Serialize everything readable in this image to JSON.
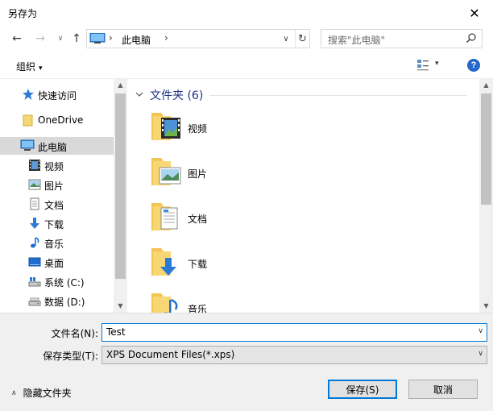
{
  "window": {
    "title": "另存为",
    "close_glyph": "✕"
  },
  "navigation": {
    "back_glyph": "←",
    "forward_glyph": "→",
    "history_glyph": "∨",
    "up_glyph": "↑",
    "address": {
      "separator": "›",
      "crumb": "此电脑",
      "crumb_icon": "pc-icon",
      "dropdown_glyph": "∨",
      "refresh_glyph": "↻"
    },
    "search": {
      "placeholder": "搜索\"此电脑\"",
      "icon": "search-icon"
    }
  },
  "toolbar": {
    "organize_label": "组织",
    "caret": "▾",
    "view_icon": "view-options-icon",
    "help_label": "?"
  },
  "sidebar": {
    "items": [
      {
        "label": "快速访问",
        "icon": "quick-access-star-icon",
        "level": 0
      },
      {
        "label": "OneDrive",
        "icon": "onedrive-folder-icon",
        "level": 0
      },
      {
        "label": "此电脑",
        "icon": "pc-icon",
        "level": 0,
        "selected": true
      },
      {
        "label": "视频",
        "icon": "videos-icon",
        "level": 1
      },
      {
        "label": "图片",
        "icon": "pictures-icon",
        "level": 1
      },
      {
        "label": "文档",
        "icon": "documents-icon",
        "level": 1
      },
      {
        "label": "下载",
        "icon": "downloads-icon",
        "level": 1
      },
      {
        "label": "音乐",
        "icon": "music-icon",
        "level": 1
      },
      {
        "label": "桌面",
        "icon": "desktop-icon",
        "level": 1
      },
      {
        "label": "系统 (C:)",
        "icon": "system-drive-icon",
        "level": 1
      },
      {
        "label": "数据 (D:)",
        "icon": "data-drive-icon",
        "level": 1
      }
    ]
  },
  "content": {
    "group_label": "文件夹 (6)",
    "folders": [
      {
        "label": "视频",
        "icon": "videos-folder-icon"
      },
      {
        "label": "图片",
        "icon": "pictures-folder-icon"
      },
      {
        "label": "文档",
        "icon": "documents-folder-icon"
      },
      {
        "label": "下载",
        "icon": "downloads-folder-icon"
      },
      {
        "label": "音乐",
        "icon": "music-folder-icon"
      }
    ]
  },
  "scroll_glyphs": {
    "up": "▲",
    "down": "▼"
  },
  "form": {
    "filename_label": "文件名(N):",
    "filename_value": "Test",
    "filetype_label": "保存类型(T):",
    "filetype_value": "XPS Document Files(*.xps)",
    "dropdown_glyph": "∨"
  },
  "footer": {
    "hide_folders_label": "隐藏文件夹",
    "hide_glyph": "∧",
    "save_label": "保存(S)",
    "cancel_label": "取消"
  },
  "colors": {
    "accent": "#0078d7",
    "folder": "#f7d774",
    "group_header": "#1e3287",
    "help": "#2568c8"
  }
}
